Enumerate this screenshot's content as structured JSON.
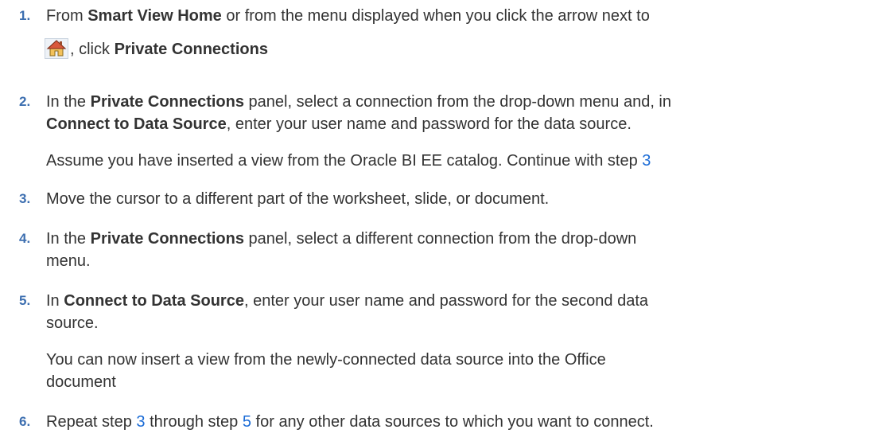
{
  "steps": [
    {
      "num": "1.",
      "a": "From ",
      "b1": "Smart View Home",
      "c": " or from the menu displayed when you click the arrow next to",
      "d": ", click ",
      "b2": "Private Connections"
    },
    {
      "num": "2.",
      "a": "In the ",
      "b1": "Private Connections",
      "c": " panel, select a connection from the drop-down menu and, in",
      "b2": "Connect to Data Source",
      "d": ", enter your user name and password for the data source.",
      "note_a": "Assume you have inserted a view from the Oracle BI EE catalog. Continue with step ",
      "note_link": "3"
    },
    {
      "num": "3.",
      "a": "Move the cursor to a different part of the worksheet, slide, or document."
    },
    {
      "num": "4.",
      "a": "In the ",
      "b1": "Private Connections",
      "c": " panel, select a different connection from the drop-down",
      "d": "menu."
    },
    {
      "num": "5.",
      "a": "In ",
      "b1": "Connect to Data Source",
      "c": ", enter your user name and password for the second data",
      "d": "source.",
      "note_a": "You can now insert a view from the newly-connected data source into the Office",
      "note_b": "document"
    },
    {
      "num": "6.",
      "a": "Repeat step ",
      "link1": "3",
      "b": " through step ",
      "link2": "5",
      "c": " for any other data sources to which you want to connect."
    }
  ],
  "icon": "home-icon",
  "colors": {
    "number": "#3d6fb0",
    "link": "#1a6bd6",
    "text": "#333333"
  }
}
